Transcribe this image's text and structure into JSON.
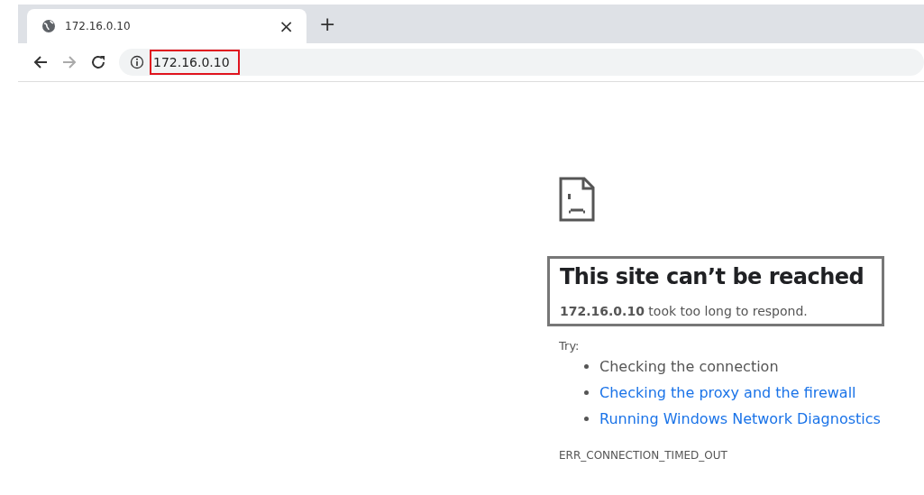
{
  "tab": {
    "title": "172.16.0.10",
    "close": "×",
    "new_tab": "+"
  },
  "toolbar": {
    "address": "172.16.0.10",
    "address_highlighted": true
  },
  "error": {
    "highlighted": true,
    "title": "This site can’t be reached",
    "message": "**172.16.0.10** took too long to respond.",
    "try_label": "Try:",
    "suggestions": [
      {
        "kind": "text",
        "label": "Checking the connection"
      },
      {
        "kind": "link",
        "label": "Checking the proxy and the firewall"
      },
      {
        "kind": "link",
        "label": "Running Windows Network Diagnostics"
      }
    ],
    "code": "ERR_CONNECTION_TIMED_OUT"
  }
}
